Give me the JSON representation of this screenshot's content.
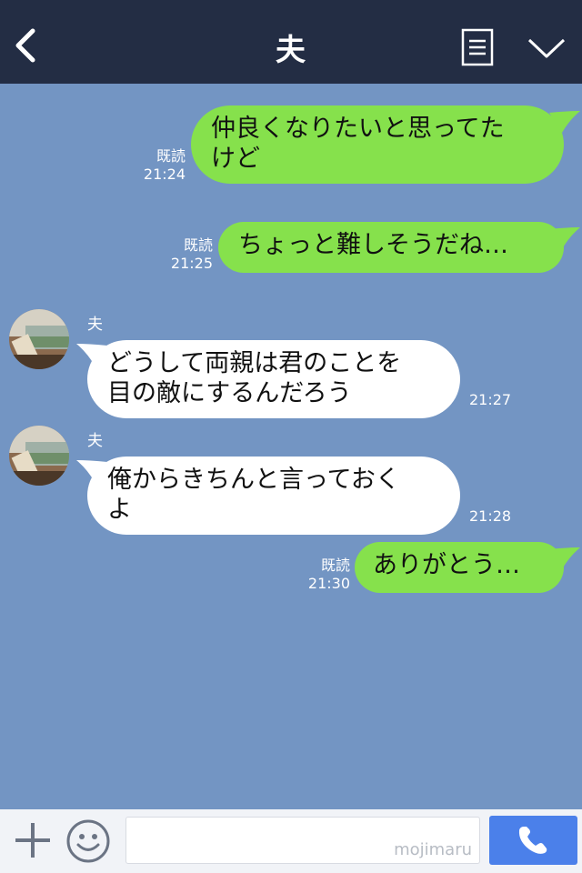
{
  "header": {
    "title": "夫"
  },
  "messages": [
    {
      "side": "right",
      "lines": [
        "仲良くなりたいと思ってた",
        "けど"
      ],
      "read": "既読",
      "time": "21:24"
    },
    {
      "side": "right",
      "lines": [
        "ちょっと難しそうだね…"
      ],
      "read": "既読",
      "time": "21:25"
    },
    {
      "side": "left",
      "sender": "夫",
      "lines": [
        "どうして両親は君のことを",
        "目の敵にするんだろう"
      ],
      "time": "21:27"
    },
    {
      "side": "left",
      "sender": "夫",
      "lines": [
        "俺からきちんと言っておく",
        "よ"
      ],
      "time": "21:28"
    },
    {
      "side": "right",
      "lines": [
        "ありがとう…"
      ],
      "read": "既読",
      "time": "21:30"
    }
  ],
  "footer": {
    "input_value": "",
    "watermark": "mojimaru"
  },
  "colors": {
    "background": "#7395c3",
    "header": "#232d44",
    "sent_bubble": "#86e14c",
    "received_bubble": "#ffffff",
    "call_button": "#4b80ea"
  }
}
